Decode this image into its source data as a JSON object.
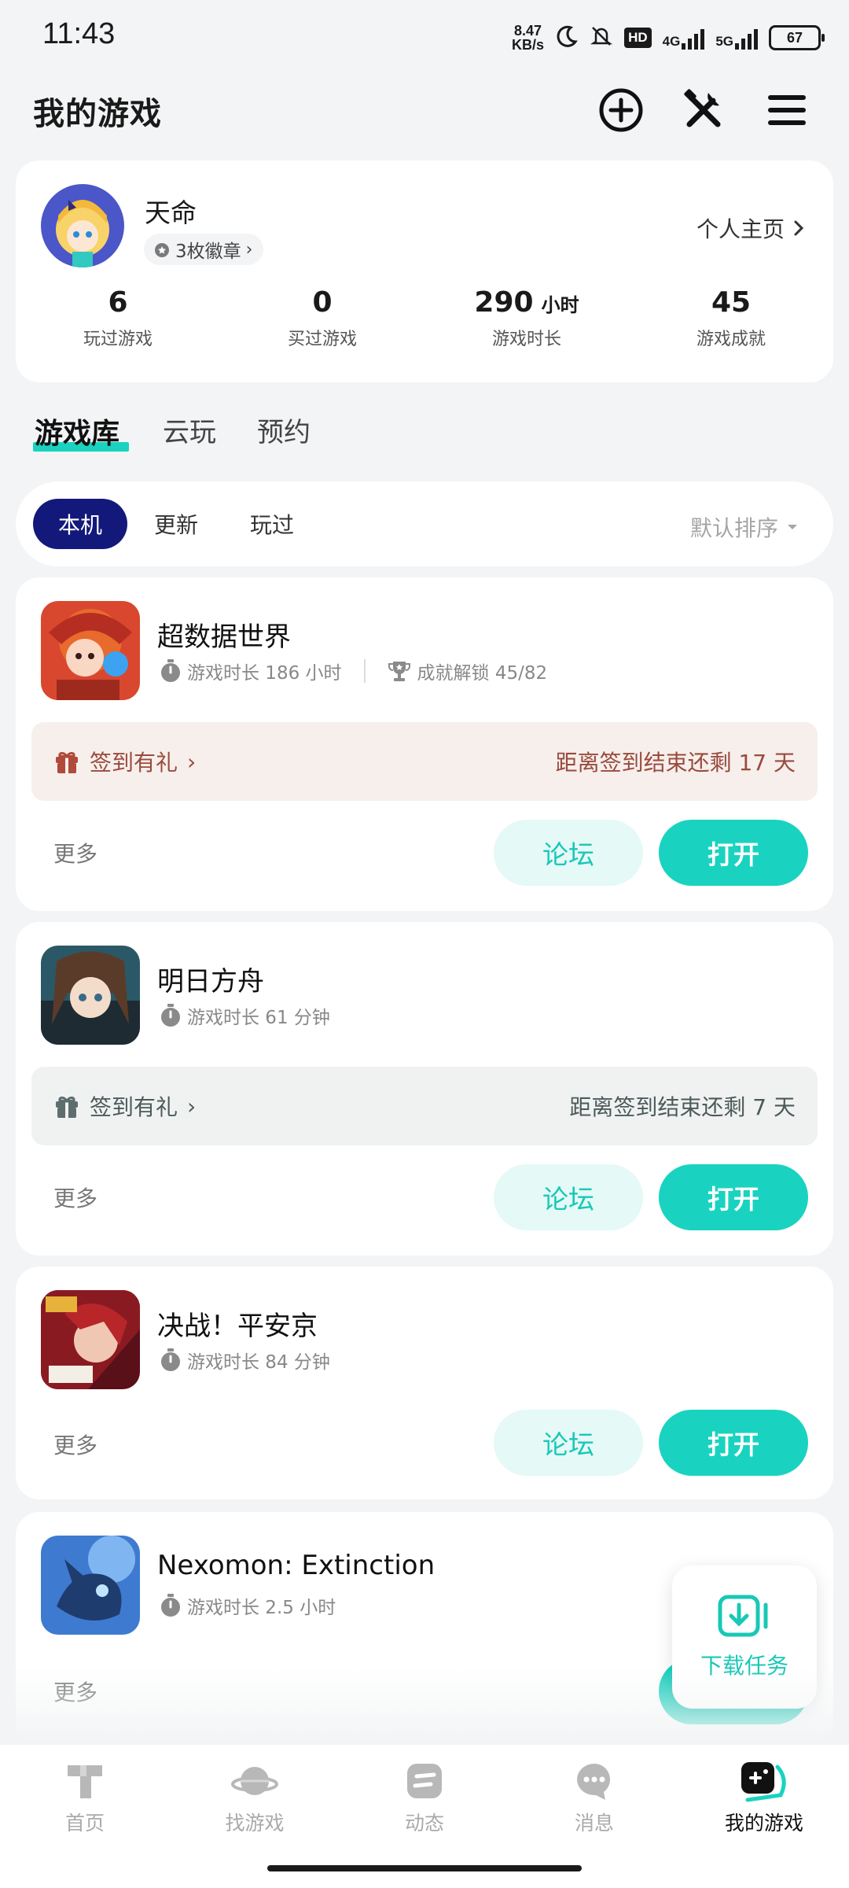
{
  "status_bar": {
    "time": "11:43",
    "net_speed": "8.47",
    "net_unit": "KB/s",
    "hd": "HD",
    "net1": "4G",
    "net2": "5G",
    "battery": "67"
  },
  "header": {
    "title": "我的游戏"
  },
  "profile": {
    "name": "天命",
    "badges": "3枚徽章",
    "homepage": "个人主页",
    "stats": [
      {
        "value": "6",
        "unit": "",
        "label": "玩过游戏"
      },
      {
        "value": "0",
        "unit": "",
        "label": "买过游戏"
      },
      {
        "value": "290",
        "unit": "小时",
        "label": "游戏时长"
      },
      {
        "value": "45",
        "unit": "",
        "label": "游戏成就"
      }
    ]
  },
  "tabs": [
    "游戏库",
    "云玩",
    "预约"
  ],
  "filters": {
    "chips": [
      "本机",
      "更新",
      "玩过"
    ],
    "sort": "默认排序"
  },
  "games": [
    {
      "title": "超数据世界",
      "playtime": "游戏时长 186 小时",
      "achievement": "成就解锁 45/82",
      "signin": "签到有礼",
      "signin_remaining": "距离签到结束还剩 17 天",
      "more": "更多",
      "forum": "论坛",
      "open": "打开"
    },
    {
      "title": "明日方舟",
      "playtime": "游戏时长 61 分钟",
      "signin": "签到有礼",
      "signin_remaining": "距离签到结束还剩 7 天",
      "more": "更多",
      "forum": "论坛",
      "open": "打开"
    },
    {
      "title": "决战！平安京",
      "playtime": "游戏时长 84 分钟",
      "more": "更多",
      "forum": "论坛",
      "open": "打开"
    },
    {
      "title": "Nexomon: Extinction",
      "playtime": "游戏时长 2.5 小时",
      "more": "更多"
    }
  ],
  "download_task": "下载任务",
  "bottom_nav": [
    "首页",
    "找游戏",
    "动态",
    "消息",
    "我的游戏"
  ],
  "colors": {
    "accent": "#19D3C0",
    "active_chip": "#13197A",
    "background": "#F2F4F5",
    "signin_warm_bg": "#F6EFEC",
    "signin_warm_text": "#9A4A3C",
    "signin_cool_bg": "#F0F2F2"
  }
}
